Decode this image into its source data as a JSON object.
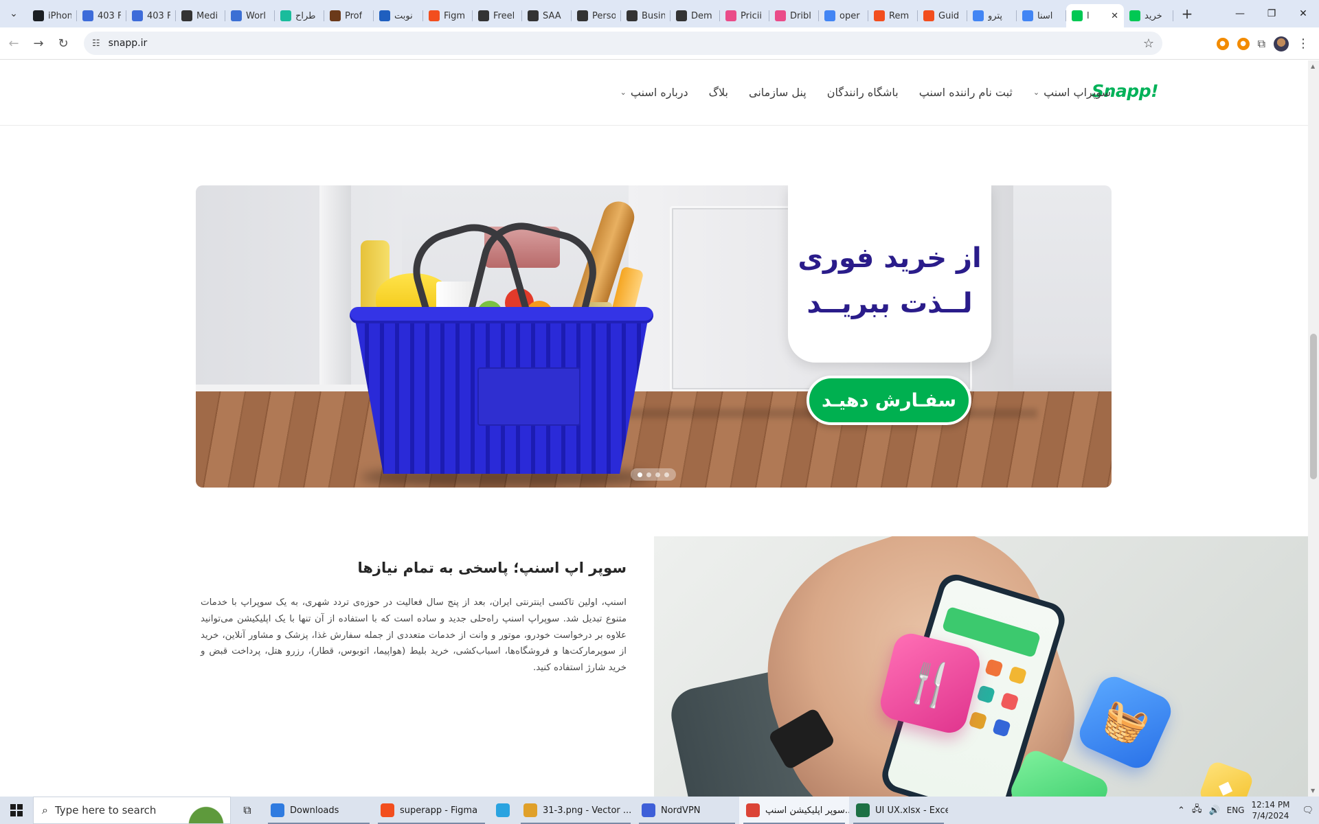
{
  "browser": {
    "tabs": [
      {
        "title": "iPhon",
        "icon": "github-icon",
        "color": "#1b1f23"
      },
      {
        "title": "403 F",
        "icon": "dribbble-bot-icon",
        "color": "#3d6bd9"
      },
      {
        "title": "403 F",
        "icon": "dribbble-bot-icon",
        "color": "#3d6bd9"
      },
      {
        "title": "Medi",
        "icon": "medium-icon",
        "color": "#333333"
      },
      {
        "title": "Worl",
        "icon": "worldwide-icon",
        "color": "#3b6fd4"
      },
      {
        "title": "طراح",
        "icon": "figma-plugin-icon",
        "color": "#1abc9c"
      },
      {
        "title": "Prof",
        "icon": "portfolio-icon",
        "color": "#6b3a1a"
      },
      {
        "title": "نوبت",
        "icon": "booking-icon",
        "color": "#1f5fbf"
      },
      {
        "title": "Figm",
        "icon": "figma-icon",
        "color": "#f24e1e"
      },
      {
        "title": "Freel",
        "icon": "globe-icon",
        "color": "#333333"
      },
      {
        "title": "SAA",
        "icon": "globe-icon",
        "color": "#333333"
      },
      {
        "title": "Perso",
        "icon": "globe-icon",
        "color": "#333333"
      },
      {
        "title": "Busin",
        "icon": "globe-icon",
        "color": "#333333"
      },
      {
        "title": "Dem",
        "icon": "globe-icon",
        "color": "#333333"
      },
      {
        "title": "Pricii",
        "icon": "dribbble-icon",
        "color": "#ea4c89"
      },
      {
        "title": "Dribl",
        "icon": "dribbble-icon",
        "color": "#ea4c89"
      },
      {
        "title": "oper",
        "icon": "google-icon",
        "color": "#4285f4"
      },
      {
        "title": "Rem",
        "icon": "figma-icon",
        "color": "#f24e1e"
      },
      {
        "title": "Guid",
        "icon": "figma-icon",
        "color": "#f24e1e"
      },
      {
        "title": "پترو",
        "icon": "google-icon",
        "color": "#4285f4"
      },
      {
        "title": "اسنا",
        "icon": "google-icon",
        "color": "#4285f4"
      },
      {
        "title": "ا",
        "icon": "snapp-icon",
        "color": "#00c853",
        "active": true
      },
      {
        "title": "خرید",
        "icon": "snapp-icon",
        "color": "#00c853"
      }
    ],
    "address": "snapp.ir"
  },
  "site": {
    "logo": "Snapp!",
    "nav": [
      {
        "label": "سوپراپ اسنپ",
        "has_dropdown": true
      },
      {
        "label": "ثبت نام راننده اسنپ",
        "has_dropdown": false
      },
      {
        "label": "باشگاه رانندگان",
        "has_dropdown": false
      },
      {
        "label": "پنل سازمانی",
        "has_dropdown": false
      },
      {
        "label": "بلاگ",
        "has_dropdown": false
      },
      {
        "label": "درباره اسنپ",
        "has_dropdown": true
      }
    ],
    "hero": {
      "line1": "از خرید فوری",
      "line2": "لــذت ببریــد",
      "cta": "سفـارش دهیـد",
      "slides": 4,
      "active_slide": 1
    },
    "superapp": {
      "title": "سوپر اپ اسنپ؛ پاسخی به تمام نیازها",
      "description": "اسنپ، اولین تاکسی اینترنتی ایران، بعد از پنج سال فعالیت در حوزه‌ی تردد شهری، به یک سوپراپ با خدمات متنوع تبدیل شد. سوپراپ اسنپ راه‌حلی جدید و ساده است که با استفاده از آن تنها با یک اپلیکیشن می‌توانید علاوه بر درخواست خودرو، موتور و وانت از خدمات متعددی از جمله سفارش غذا، پزشک و مشاور آنلاین، خرید از سوپرمارکت‌ها و فروشگاه‌ها، اسباب‌کشی، خرید بلیط (هواپیما، اتوبوس، قطار)، رزرو هتل، پرداخت قبض و خرید شارژ استفاده کنید."
    }
  },
  "taskbar": {
    "search_placeholder": "Type here to search",
    "apps": [
      {
        "label": "Downloads",
        "icon": "download-folder-icon",
        "color": "#2f7be0"
      },
      {
        "label": "superapp - Figma",
        "icon": "figma-icon",
        "color": "#f24e1e"
      },
      {
        "label": "",
        "icon": "telegram-icon",
        "color": "#2aa3e0"
      },
      {
        "label": "31-3.png - Vector ...",
        "icon": "vector-magic-icon",
        "color": "#e0a02a"
      },
      {
        "label": "NordVPN",
        "icon": "nordvpn-icon",
        "color": "#3e5fd8"
      },
      {
        "label": "سوپر اپلیکیشن اسنپ...",
        "icon": "chrome-icon",
        "color": "#db4437",
        "active": true
      },
      {
        "label": "UI  UX.xlsx - Excel",
        "icon": "excel-icon",
        "color": "#1d7044"
      }
    ],
    "tray": {
      "language": "ENG",
      "time": "12:14 PM",
      "date": "7/4/2024"
    }
  }
}
